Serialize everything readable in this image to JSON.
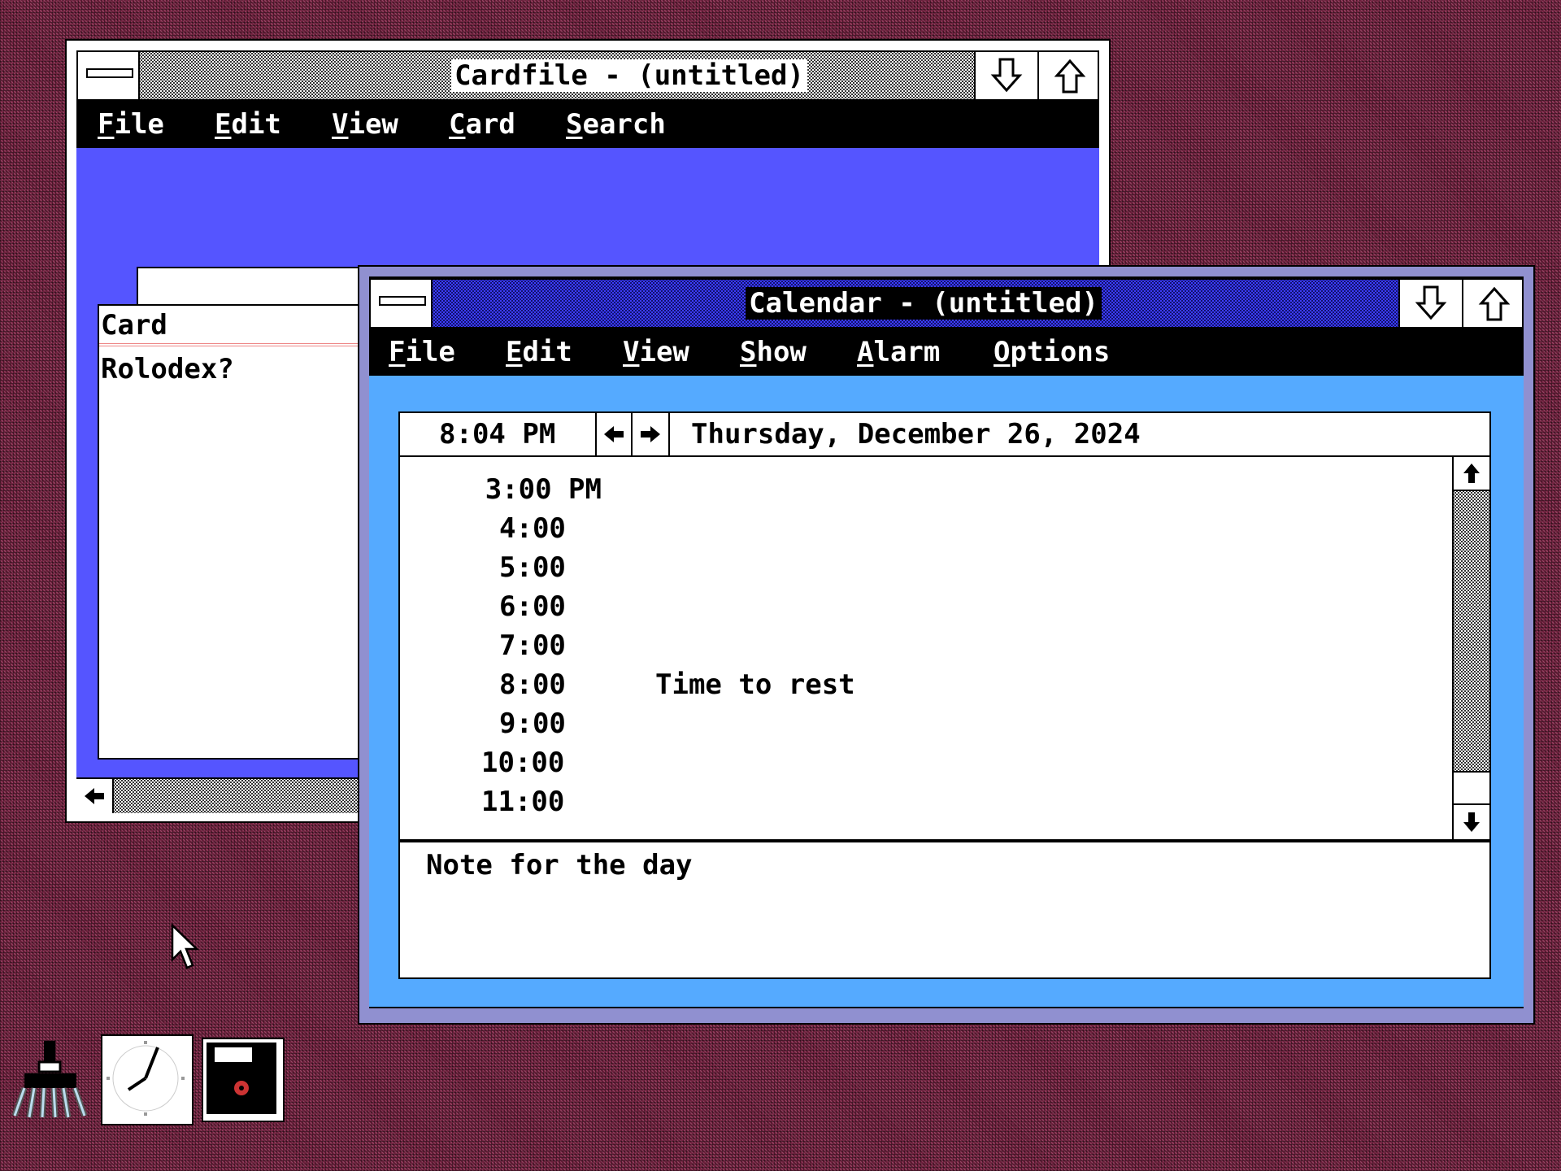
{
  "cardfile": {
    "title": "Cardfile - (untitled)",
    "menu": [
      {
        "key": "F",
        "rest": "ile"
      },
      {
        "key": "E",
        "rest": "dit"
      },
      {
        "key": "V",
        "rest": "iew"
      },
      {
        "key": "C",
        "rest": "ard"
      },
      {
        "key": "S",
        "rest": "earch"
      }
    ],
    "card_header": "Card",
    "card_body": "Rolodex?",
    "colors": {
      "client": "#5555ff"
    }
  },
  "calendar": {
    "title": "Calendar - (untitled)",
    "menu": [
      {
        "key": "F",
        "rest": "ile"
      },
      {
        "key": "E",
        "rest": "dit"
      },
      {
        "key": "V",
        "rest": "iew"
      },
      {
        "key": "S",
        "rest": "how"
      },
      {
        "key": "A",
        "rest": "larm"
      },
      {
        "key": "O",
        "rest": "ptions"
      }
    ],
    "current_time": "8:04 PM",
    "date": "Thursday, December 26, 2024",
    "slots": [
      {
        "time": "3:00 PM",
        "note": ""
      },
      {
        "time": "4:00",
        "note": ""
      },
      {
        "time": "5:00",
        "note": ""
      },
      {
        "time": "6:00",
        "note": ""
      },
      {
        "time": "7:00",
        "note": ""
      },
      {
        "time": "8:00",
        "note": "Time to rest"
      },
      {
        "time": "9:00",
        "note": ""
      },
      {
        "time": "10:00",
        "note": ""
      },
      {
        "time": "11:00",
        "note": ""
      }
    ],
    "day_note": "Note for the day",
    "colors": {
      "client": "#55aaff",
      "border": "#9090d0"
    }
  },
  "desktop": {
    "icons": [
      "paint-brush-icon",
      "clock-icon",
      "floppy-disk-icon"
    ],
    "background": "#6e1f3c"
  }
}
